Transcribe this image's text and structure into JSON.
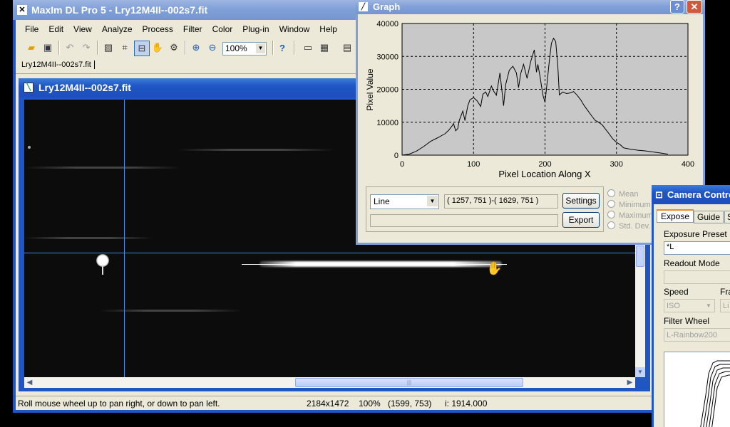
{
  "main_window": {
    "title": "MaxIm DL Pro 5 - Lry12M4II--002s7.fit",
    "menu": [
      "File",
      "Edit",
      "View",
      "Analyze",
      "Process",
      "Filter",
      "Color",
      "Plug-in",
      "Window",
      "Help"
    ],
    "zoom_value": "100%",
    "doc_tab": "Lry12M4II--002s7.fit"
  },
  "image_window": {
    "title": "Lry12M4II--002s7.fit"
  },
  "status_bar": {
    "hint": "Roll mouse wheel up to pan right, or down to pan left.",
    "dimensions": "2184x1472",
    "zoom": "100%",
    "coords": "(1599, 753)",
    "intensity": "i:  1914.000"
  },
  "graph_window": {
    "title": "Graph",
    "mode": "Line",
    "coords": "( 1257, 751 )-( 1629, 751 )",
    "settings_label": "Settings",
    "export_label": "Export",
    "options": [
      "Mean",
      "Minimum",
      "Maximum",
      "Std. Dev."
    ]
  },
  "camera_window": {
    "title": "Camera Control",
    "tabs": [
      "Expose",
      "Guide",
      "S"
    ],
    "exposure_preset_label": "Exposure Preset",
    "exposure_preset_value": "*L",
    "readout_mode_label": "Readout Mode",
    "readout_mode_value": "",
    "speed_label": "Speed",
    "speed_value": "ISO",
    "frame_label": "Fra",
    "frame_value": "Li",
    "filter_wheel_label": "Filter Wheel",
    "filter_wheel_value": "L-Rainbow200"
  },
  "colors": {
    "xp_blue": "#1f56c4",
    "window_face": "#ece9d8",
    "plot_bg": "#c8c8c8"
  },
  "chart_data": {
    "type": "line",
    "title": "",
    "xlabel": "Pixel Location Along X",
    "ylabel": "Pixel Value",
    "xlim": [
      0,
      400
    ],
    "ylim": [
      0,
      40000
    ],
    "x_ticks": [
      0,
      100,
      200,
      300,
      400
    ],
    "y_ticks": [
      0,
      10000,
      20000,
      30000,
      40000
    ],
    "grid": true,
    "series": [
      {
        "x": [
          0,
          10,
          20,
          30,
          40,
          50,
          60,
          65,
          70,
          72,
          75,
          78,
          80,
          85,
          88,
          92,
          95,
          100,
          105,
          110,
          113,
          117,
          120,
          125,
          128,
          132,
          137,
          142,
          145,
          150,
          155,
          160,
          163,
          166,
          170,
          175,
          180,
          185,
          188,
          190,
          193,
          197,
          200,
          203,
          206,
          209,
          212,
          215,
          218,
          220,
          225,
          230,
          235,
          240,
          245,
          250,
          255,
          260,
          265,
          270,
          275,
          280,
          285,
          290,
          295,
          300,
          305,
          310,
          320,
          330,
          340,
          350,
          360,
          372
        ],
        "y": [
          0,
          300,
          1200,
          2600,
          4200,
          5300,
          6500,
          7500,
          8900,
          9600,
          7400,
          8100,
          10500,
          13400,
          10500,
          15000,
          16800,
          17500,
          16500,
          14800,
          18500,
          19200,
          17800,
          21000,
          19500,
          18200,
          25000,
          15000,
          21500,
          25800,
          27000,
          25000,
          20500,
          24800,
          27600,
          23300,
          28500,
          32000,
          25200,
          27600,
          23900,
          18300,
          16000,
          22100,
          28500,
          34000,
          35500,
          34500,
          27000,
          18300,
          19200,
          18700,
          18900,
          19300,
          18200,
          16800,
          15000,
          13500,
          12000,
          10600,
          10000,
          9200,
          7800,
          6400,
          4900,
          3900,
          3200,
          2200,
          1800,
          1500,
          1300,
          1000,
          700,
          300
        ]
      }
    ]
  }
}
